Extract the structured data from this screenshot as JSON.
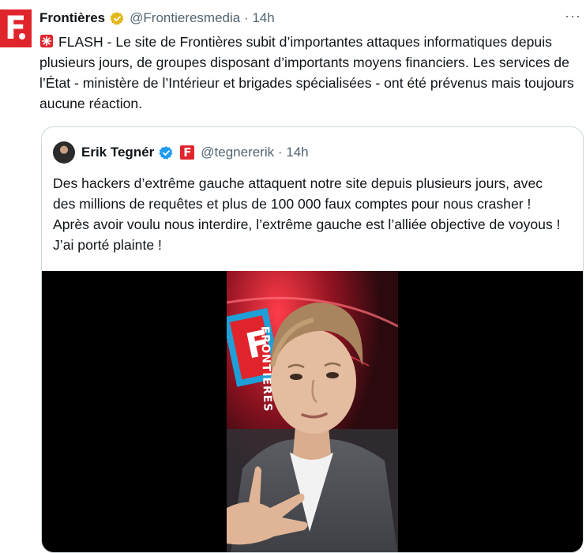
{
  "tweet": {
    "display_name": "Frontières",
    "handle_time": "@Frontieresmedia · 14h",
    "more_label": "···",
    "text": "FLASH - Le site de Frontières subit d’importantes attaques informatiques depuis plusieurs jours, de groupes disposant d’importants moyens financiers. Les services de l’État - ministère de l’Intérieur et brigades spécialisées - ont été prévenus mais toujours aucune réaction."
  },
  "quote": {
    "display_name": "Erik Tegnér",
    "handle_time": "@tegnererik · 14h",
    "text": "Des hackers d’extrême gauche attaquent notre site depuis plusieurs jours, avec des millions de requêtes et plus de 100 000 faux comptes pour nous crasher ! Après avoir voulu nous interdire, l’extrême gauche est l’alliée objective de voyous ! J’ai porté plainte !"
  },
  "logo": {
    "letter": "F.",
    "vertical_text": "FRONTIÈRES"
  },
  "colors": {
    "brand_red": "#e0242b",
    "verified_gold": "#e2b719",
    "verified_blue": "#1d9bf0",
    "secondary_text": "#536471"
  },
  "icons": {
    "verified_main": "verified-gold-badge-icon",
    "verified_quote": "verified-blue-badge-icon",
    "siren": "siren-emoji-icon"
  }
}
